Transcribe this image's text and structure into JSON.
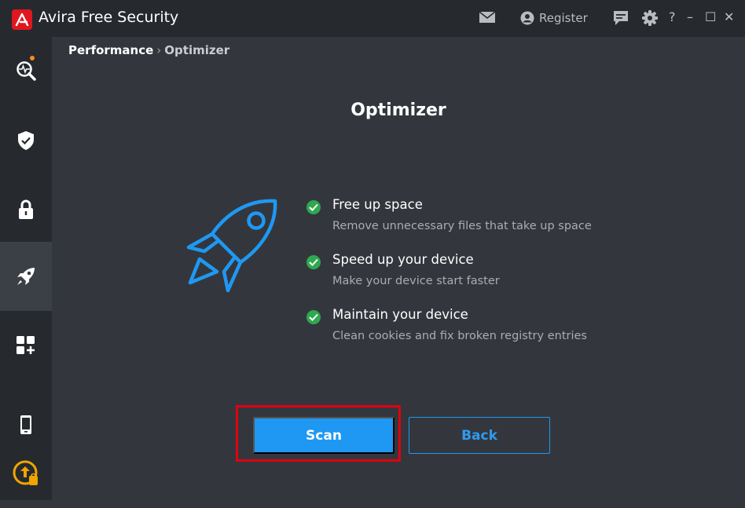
{
  "app": {
    "brand": "Avira",
    "product": "Free Security",
    "register_label": "Register",
    "accent_color": "#e0171f"
  },
  "window_controls": {
    "help": "?",
    "minimize": "–",
    "maximize": "☐",
    "close": "✕"
  },
  "sidebar": {
    "items": [
      {
        "name": "status-scan",
        "icon": "pulse-search-icon",
        "active": false
      },
      {
        "name": "security",
        "icon": "shield-check-icon",
        "active": false
      },
      {
        "name": "privacy",
        "icon": "lock-icon",
        "active": false
      },
      {
        "name": "performance",
        "icon": "rocket-icon",
        "active": true
      },
      {
        "name": "apps",
        "icon": "apps-plus-icon",
        "active": false
      },
      {
        "name": "mobile",
        "icon": "phone-icon",
        "active": false
      },
      {
        "name": "upgrade",
        "icon": "upgrade-icon",
        "active": false
      }
    ]
  },
  "breadcrumb": {
    "parent": "Performance",
    "separator": "›",
    "current": "Optimizer"
  },
  "main": {
    "title": "Optimizer",
    "features": [
      {
        "title": "Free up space",
        "description": "Remove unnecessary files that take up space"
      },
      {
        "title": "Speed up your device",
        "description": "Make your device start faster"
      },
      {
        "title": "Maintain your device",
        "description": "Clean cookies and fix broken registry entries"
      }
    ],
    "scan_label": "Scan",
    "back_label": "Back"
  }
}
